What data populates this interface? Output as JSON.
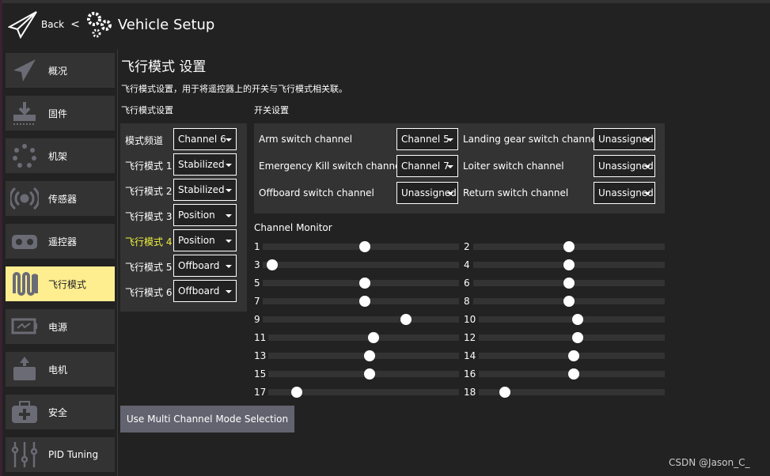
{
  "header": {
    "back_label": "Back",
    "separator": "<",
    "title": "Vehicle Setup"
  },
  "sidebar": {
    "items": [
      {
        "label": "概况",
        "icon": "paper-plane-icon"
      },
      {
        "label": "固件",
        "icon": "download-icon"
      },
      {
        "label": "机架",
        "icon": "airframe-icon"
      },
      {
        "label": "传感器",
        "icon": "sensor-icon"
      },
      {
        "label": "遥控器",
        "icon": "radio-icon"
      },
      {
        "label": "飞行模式",
        "icon": "flight-modes-icon",
        "selected": true
      },
      {
        "label": "电源",
        "icon": "battery-icon"
      },
      {
        "label": "电机",
        "icon": "motor-icon"
      },
      {
        "label": "安全",
        "icon": "safety-icon"
      },
      {
        "label": "PID Tuning",
        "icon": "sliders-icon"
      }
    ]
  },
  "main": {
    "title": "飞行模式 设置",
    "description": "飞行模式设置，用于将遥控器上的开关与飞行模式相关联。",
    "flight_modes_heading": "飞行模式设置",
    "switch_heading": "开关设置",
    "mode_channel": {
      "label": "模式频道",
      "value": "Channel 6"
    },
    "modes": [
      {
        "label": "飞行模式 1",
        "value": "Stabilized",
        "active": false
      },
      {
        "label": "飞行模式 2",
        "value": "Stabilized",
        "active": false
      },
      {
        "label": "飞行模式 3",
        "value": "Position",
        "active": false
      },
      {
        "label": "飞行模式 4",
        "value": "Position",
        "active": true
      },
      {
        "label": "飞行模式 5",
        "value": "Offboard",
        "active": false
      },
      {
        "label": "飞行模式 6",
        "value": "Offboard",
        "active": false
      }
    ],
    "switches": [
      {
        "label": "Arm switch channel",
        "value": "Channel 5"
      },
      {
        "label": "Landing gear switch channel",
        "value": "Unassigned"
      },
      {
        "label": "Emergency Kill switch channel",
        "value": "Channel 7"
      },
      {
        "label": "Loiter switch channel",
        "value": "Unassigned"
      },
      {
        "label": "Offboard switch channel",
        "value": "Unassigned"
      },
      {
        "label": "Return switch channel",
        "value": "Unassigned"
      }
    ],
    "channel_monitor": {
      "title": "Channel Monitor",
      "channels": [
        {
          "n": "1",
          "level": 0.52
        },
        {
          "n": "2",
          "level": 0.5
        },
        {
          "n": "3",
          "level": 0.05
        },
        {
          "n": "4",
          "level": 0.5
        },
        {
          "n": "5",
          "level": 0.52
        },
        {
          "n": "6",
          "level": 0.5
        },
        {
          "n": "7",
          "level": 0.52
        },
        {
          "n": "8",
          "level": 0.5
        },
        {
          "n": "9",
          "level": 0.73
        },
        {
          "n": "10",
          "level": 0.53
        },
        {
          "n": "11",
          "level": 0.55
        },
        {
          "n": "12",
          "level": 0.53
        },
        {
          "n": "13",
          "level": 0.53
        },
        {
          "n": "14",
          "level": 0.51
        },
        {
          "n": "15",
          "level": 0.53
        },
        {
          "n": "16",
          "level": 0.51
        },
        {
          "n": "17",
          "level": 0.15
        },
        {
          "n": "18",
          "level": 0.14
        }
      ]
    },
    "multi_channel_button": "Use Multi Channel Mode Selection"
  },
  "colors": {
    "selected": "#ffee90",
    "active_mode": "#f0f040",
    "panel": "#333333",
    "button": "#636370"
  },
  "watermark": "CSDN @Jason_C_"
}
